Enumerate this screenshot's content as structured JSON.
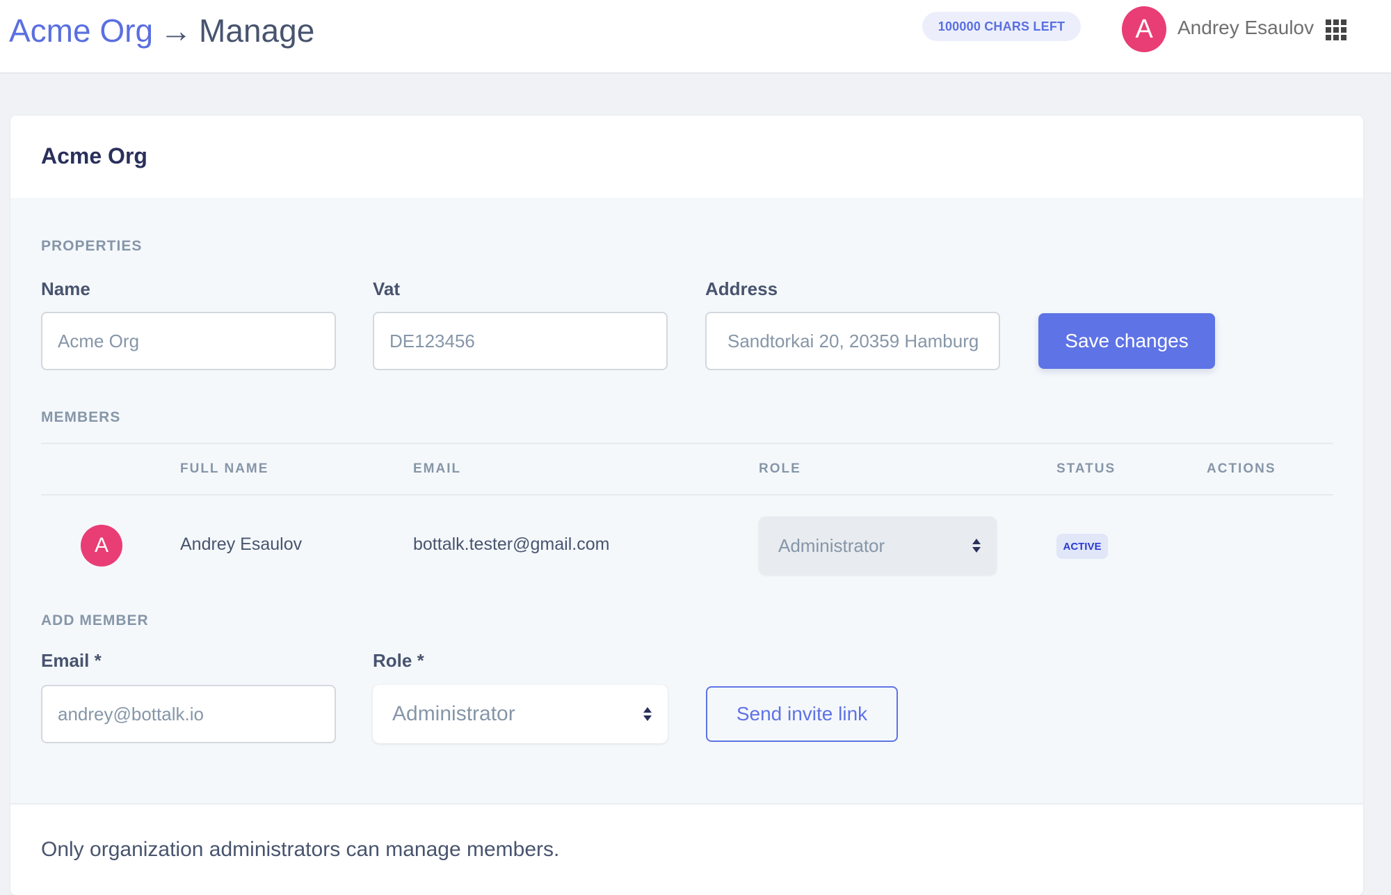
{
  "header": {
    "breadcrumb": {
      "org_link": "Acme Org",
      "separator": "→",
      "current": "Manage"
    },
    "chars_left_badge": "100000 CHARS LEFT",
    "user": {
      "avatar_initial": "A",
      "name": "Andrey Esaulov"
    },
    "apps_icon": "grid-apps-icon"
  },
  "card": {
    "title": "Acme Org",
    "properties": {
      "section_label": "PROPERTIES",
      "name_label": "Name",
      "name_value": "Acme Org",
      "vat_label": "Vat",
      "vat_value": "DE123456",
      "address_label": "Address",
      "address_value": "Sandtorkai 20, 20359 Hamburg",
      "save_button": "Save changes"
    },
    "members": {
      "section_label": "MEMBERS",
      "columns": [
        "",
        "FULL NAME",
        "EMAIL",
        "ROLE",
        "STATUS",
        "ACTIONS"
      ],
      "rows": [
        {
          "avatar_initial": "A",
          "full_name": "Andrey Esaulov",
          "email": "bottalk.tester@gmail.com",
          "role": "Administrator",
          "status": "ACTIVE",
          "actions": ""
        }
      ]
    },
    "add_member": {
      "section_label": "ADD MEMBER",
      "email_label": "Email *",
      "email_placeholder": "andrey@bottalk.io",
      "role_label": "Role *",
      "role_value": "Administrator",
      "send_button": "Send invite link"
    },
    "footer_note": "Only organization administrators can manage members."
  },
  "colors": {
    "accent": "#5e73e5",
    "avatar": "#e93d76",
    "status_active_text": "#2a3bd4",
    "status_active_bg": "#e1e6f8",
    "heading": "#2a2f5b",
    "muted": "#8696a8"
  }
}
